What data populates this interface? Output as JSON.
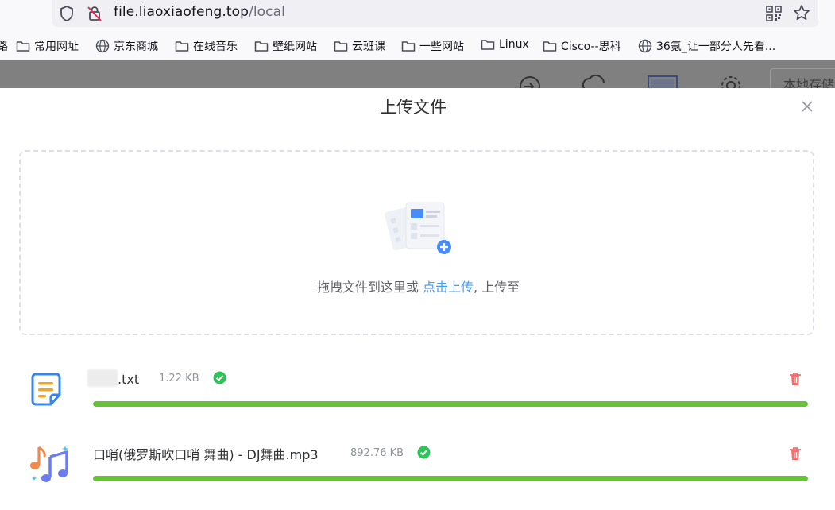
{
  "browser": {
    "url_host": "file.liaoxiaofeng.top",
    "url_path": "/local",
    "bookmarks": [
      {
        "label": "常用网址",
        "icon": "folder-icon"
      },
      {
        "label": "京东商城",
        "icon": "globe-icon"
      },
      {
        "label": "在线音乐",
        "icon": "folder-icon"
      },
      {
        "label": "壁纸网站",
        "icon": "folder-icon"
      },
      {
        "label": "云班课",
        "icon": "folder-icon"
      },
      {
        "label": "一些网站",
        "icon": "folder-icon"
      },
      {
        "label": "Linux",
        "icon": "folder-icon"
      },
      {
        "label": "Cisco--思科",
        "icon": "folder-icon"
      },
      {
        "label": "36氪_让一部分人先看...",
        "icon": "globe-icon"
      }
    ],
    "bookmark_prefix": "路"
  },
  "app": {
    "storage_label": "本地存储"
  },
  "dialog": {
    "title": "上传文件",
    "dropzone_text": "拖拽文件到这里或 ",
    "dropzone_link": "点击上传",
    "dropzone_suffix": ", 上传至"
  },
  "files": [
    {
      "name_suffix": ".txt",
      "size": "1.22 KB",
      "progress": 1.0,
      "status": "success",
      "icon": "text-file-icon"
    },
    {
      "name": "口哨(俄罗斯吹口哨 舞曲) - DJ舞曲.mp3",
      "size": "892.76 KB",
      "progress": 1.0,
      "status": "success",
      "icon": "music-file-icon"
    }
  ],
  "colors": {
    "accent": "#409eff",
    "success": "#67c23a",
    "success_check": "#2fc25b",
    "danger": "#f56c6c"
  }
}
